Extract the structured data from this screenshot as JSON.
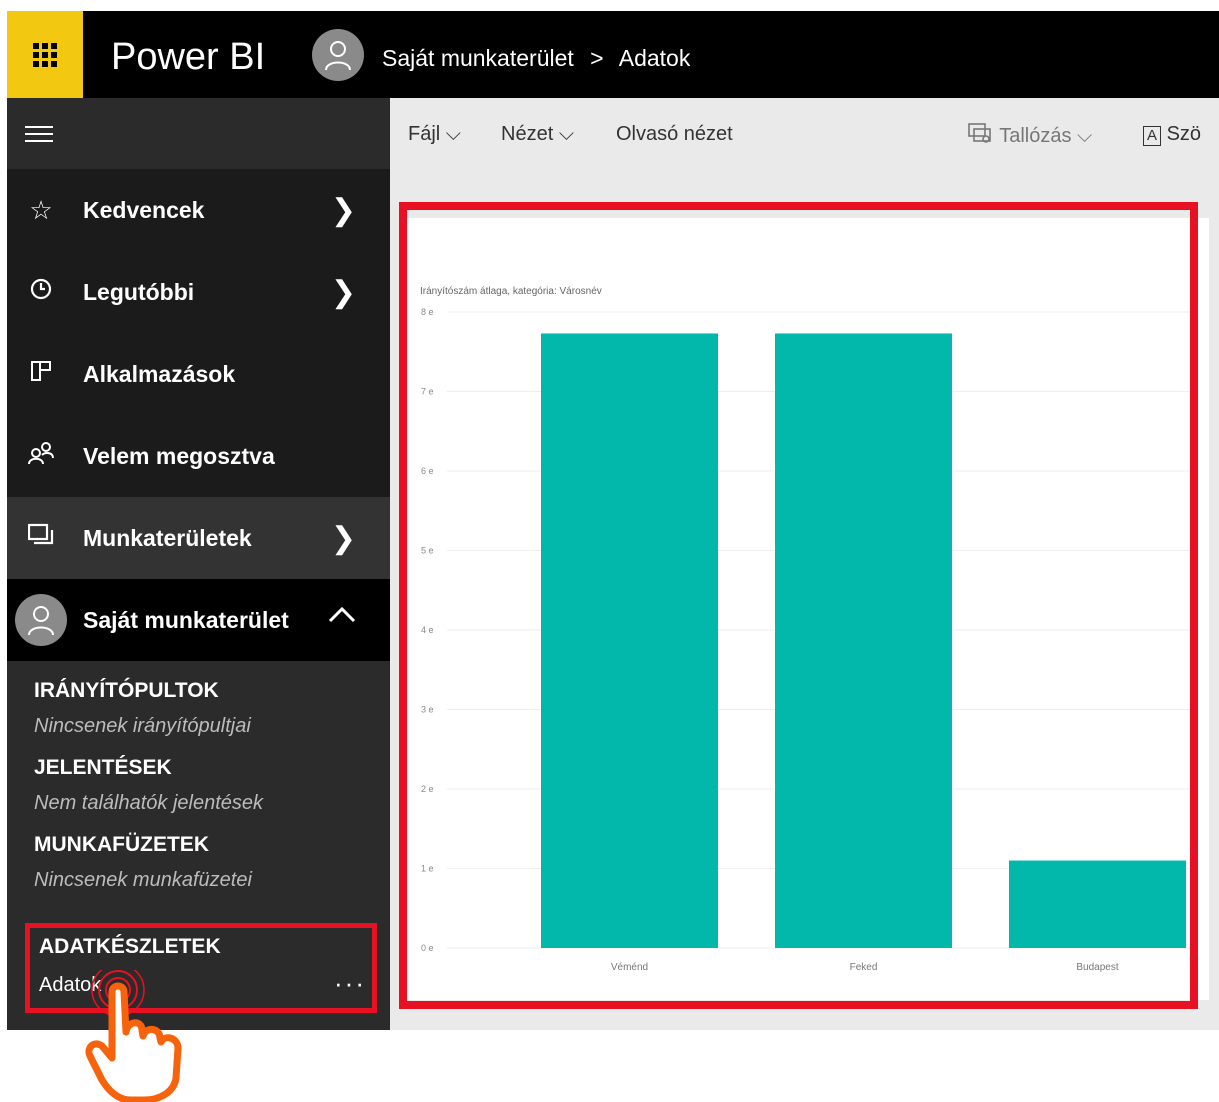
{
  "header": {
    "brand": "Power BI",
    "breadcrumb_workspace": "Saját munkaterület",
    "breadcrumb_separator": ">",
    "breadcrumb_item": "Adatok"
  },
  "sidebar": {
    "nav": [
      {
        "label": "Kedvencek",
        "icon": "star-icon"
      },
      {
        "label": "Legutóbbi",
        "icon": "clock-icon"
      },
      {
        "label": "Alkalmazások",
        "icon": "apps-icon"
      },
      {
        "label": "Velem megosztva",
        "icon": "shared-people-icon"
      },
      {
        "label": "Munkaterületek",
        "icon": "workspaces-icon"
      },
      {
        "label": "Saját munkaterület",
        "icon": "avatar"
      }
    ],
    "sections": [
      {
        "title": "IRÁNYÍTÓPULTOK",
        "empty": "Nincsenek irányítópultjai"
      },
      {
        "title": "JELENTÉSEK",
        "empty": "Nem találhatók jelentések"
      },
      {
        "title": "MUNKAFÜZETEK",
        "empty": "Nincsenek munkafüzetei"
      }
    ],
    "datasets": {
      "title": "ADATKÉSZLETEK",
      "item": "Adatok",
      "more": "···"
    }
  },
  "toolbar": {
    "file": "Fájl",
    "view": "Nézet",
    "reading_view": "Olvasó nézet",
    "explore": "Tallózás",
    "text": "Szö"
  },
  "chart_data": {
    "type": "bar",
    "title": "Irányítószám átlaga, kategória: Városnév",
    "categories": [
      "Véménd",
      "Feked",
      "Budapest"
    ],
    "values": [
      7.73,
      7.73,
      1.1
    ],
    "ylim": [
      0,
      8
    ],
    "yticks": [
      "0 e",
      "1 e",
      "2 e",
      "3 e",
      "4 e",
      "5 e",
      "6 e",
      "7 e",
      "8 e"
    ],
    "grid": true,
    "bar_color": "#01b8aa"
  },
  "colors": {
    "accent": "#f2c811",
    "highlight": "#e81123",
    "sidebar": "#2b2b2b"
  }
}
